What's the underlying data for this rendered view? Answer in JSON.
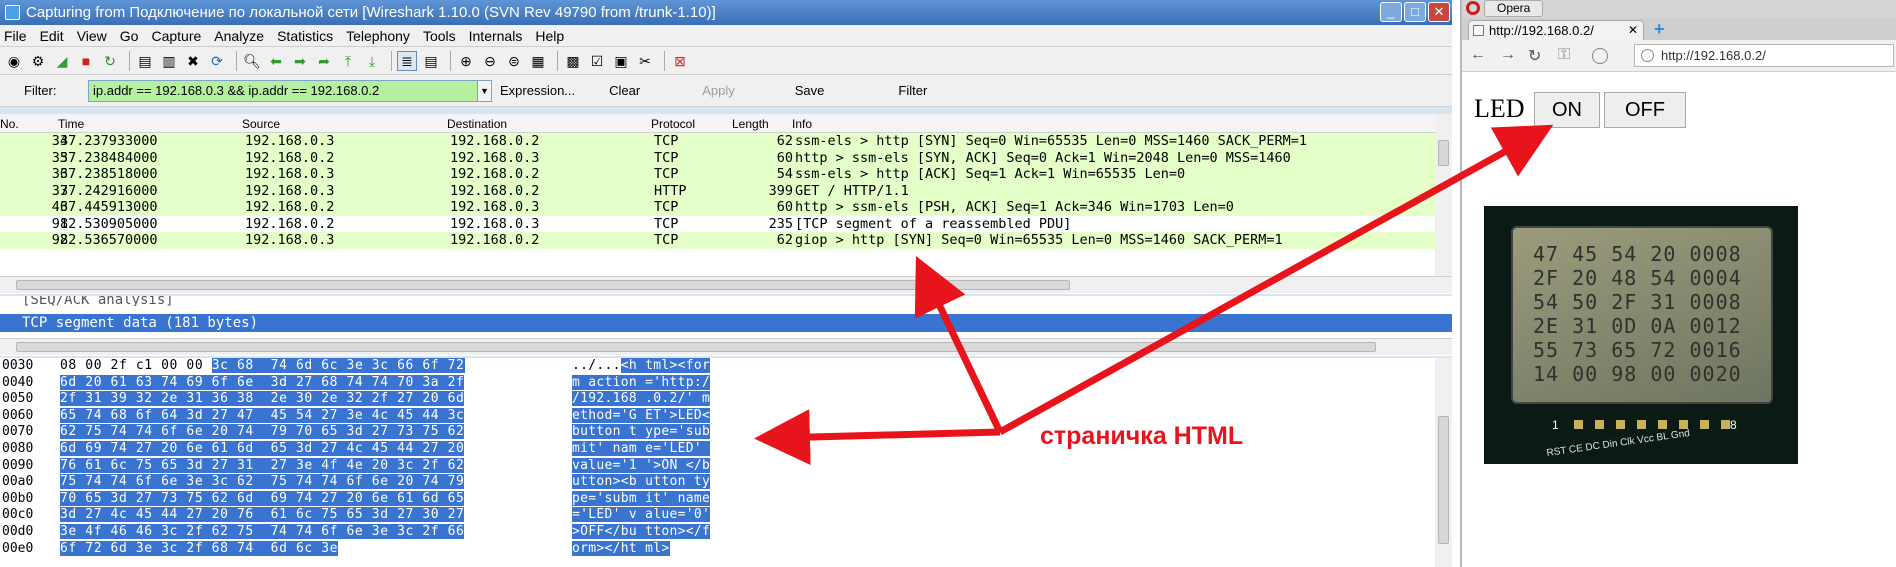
{
  "wireshark": {
    "title": "Capturing from Подключение по локальной сети    [Wireshark 1.10.0  (SVN Rev 49790 from /trunk-1.10)]",
    "window_buttons": [
      "_",
      "□",
      "✕"
    ],
    "menu": [
      "File",
      "Edit",
      "View",
      "Go",
      "Capture",
      "Analyze",
      "Statistics",
      "Telephony",
      "Tools",
      "Internals",
      "Help"
    ],
    "filter": {
      "label": "Filter:",
      "value": "ip.addr == 192.168.0.3 && ip.addr == 192.168.0.2",
      "expression": "Expression...",
      "clear": "Clear",
      "apply": "Apply",
      "save": "Save",
      "filter_btn": "Filter"
    },
    "columns": {
      "no": "No.",
      "time": "Time",
      "source": "Source",
      "destination": "Destination",
      "protocol": "Protocol",
      "length": "Length",
      "info": "Info"
    },
    "packets": [
      {
        "no": "34",
        "time": "37.237933000",
        "src": "192.168.0.3",
        "dst": "192.168.0.2",
        "proto": "TCP",
        "len": "62",
        "info": "ssm-els > http [SYN] Seq=0 Win=65535 Len=0 MSS=1460 SACK_PERM=1",
        "bg": "#e4ffc7"
      },
      {
        "no": "35",
        "time": "37.238484000",
        "src": "192.168.0.2",
        "dst": "192.168.0.3",
        "proto": "TCP",
        "len": "60",
        "info": "http > ssm-els [SYN, ACK] Seq=0 Ack=1 Win=2048 Len=0 MSS=1460",
        "bg": "#e4ffc7"
      },
      {
        "no": "36",
        "time": "37.238518000",
        "src": "192.168.0.3",
        "dst": "192.168.0.2",
        "proto": "TCP",
        "len": "54",
        "info": "ssm-els > http [ACK] Seq=1 Ack=1 Win=65535 Len=0",
        "bg": "#e4ffc7"
      },
      {
        "no": "37",
        "time": "37.242916000",
        "src": "192.168.0.3",
        "dst": "192.168.0.2",
        "proto": "HTTP",
        "len": "399",
        "info": "GET / HTTP/1.1",
        "bg": "#e4ffc7"
      },
      {
        "no": "46",
        "time": "37.445913000",
        "src": "192.168.0.2",
        "dst": "192.168.0.3",
        "proto": "TCP",
        "len": "60",
        "info": "http > ssm-els [PSH, ACK] Seq=1 Ack=346 Win=1703 Len=0",
        "bg": "#e4ffc7"
      },
      {
        "no": "91",
        "time": "82.530905000",
        "src": "192.168.0.2",
        "dst": "192.168.0.3",
        "proto": "TCP",
        "len": "235",
        "info": "[TCP segment of a reassembled PDU]",
        "bg": "#ffffff"
      },
      {
        "no": "92",
        "time": "82.536570000",
        "src": "192.168.0.3",
        "dst": "192.168.0.2",
        "proto": "TCP",
        "len": "62",
        "info": "giop > http [SYN] Seq=0 Win=65535 Len=0 MSS=1460 SACK_PERM=1",
        "bg": "#e4ffc7"
      }
    ],
    "details": {
      "partial": "[SEQ/ACK analysis]",
      "selected": "TCP segment data (181 bytes)"
    },
    "bytes": [
      {
        "off": "0030",
        "hex_plain": "08 00 2f c1 00 00 ",
        "hex_hl": "3c 68  74 6d 6c 3e 3c 66 6f 72",
        "asc_plain": "../...",
        "asc_hl": "<h tml><for"
      },
      {
        "off": "0040",
        "hex_plain": "",
        "hex_hl": "6d 20 61 63 74 69 6f 6e  3d 27 68 74 74 70 3a 2f",
        "asc_plain": "",
        "asc_hl": "m action ='http:/"
      },
      {
        "off": "0050",
        "hex_plain": "",
        "hex_hl": "2f 31 39 32 2e 31 36 38  2e 30 2e 32 2f 27 20 6d",
        "asc_plain": "",
        "asc_hl": "/192.168 .0.2/' m"
      },
      {
        "off": "0060",
        "hex_plain": "",
        "hex_hl": "65 74 68 6f 64 3d 27 47  45 54 27 3e 4c 45 44 3c",
        "asc_plain": "",
        "asc_hl": "ethod='G ET'>LED<"
      },
      {
        "off": "0070",
        "hex_plain": "",
        "hex_hl": "62 75 74 74 6f 6e 20 74  79 70 65 3d 27 73 75 62",
        "asc_plain": "",
        "asc_hl": "button t ype='sub"
      },
      {
        "off": "0080",
        "hex_plain": "",
        "hex_hl": "6d 69 74 27 20 6e 61 6d  65 3d 27 4c 45 44 27 20",
        "asc_plain": "",
        "asc_hl": "mit' nam e='LED' "
      },
      {
        "off": "0090",
        "hex_plain": "",
        "hex_hl": "76 61 6c 75 65 3d 27 31  27 3e 4f 4e 20 3c 2f 62",
        "asc_plain": "",
        "asc_hl": "value='1 '>ON </b"
      },
      {
        "off": "00a0",
        "hex_plain": "",
        "hex_hl": "75 74 74 6f 6e 3e 3c 62  75 74 74 6f 6e 20 74 79",
        "asc_plain": "",
        "asc_hl": "utton><b utton ty"
      },
      {
        "off": "00b0",
        "hex_plain": "",
        "hex_hl": "70 65 3d 27 73 75 62 6d  69 74 27 20 6e 61 6d 65",
        "asc_plain": "",
        "asc_hl": "pe='subm it' name"
      },
      {
        "off": "00c0",
        "hex_plain": "",
        "hex_hl": "3d 27 4c 45 44 27 20 76  61 6c 75 65 3d 27 30 27",
        "asc_plain": "",
        "asc_hl": "='LED' v alue='0'"
      },
      {
        "off": "00d0",
        "hex_plain": "",
        "hex_hl": "3e 4f 46 46 3c 2f 62 75  74 74 6f 6e 3e 3c 2f 66",
        "asc_plain": "",
        "asc_hl": ">OFF</bu tton></f"
      },
      {
        "off": "00e0",
        "hex_plain": "",
        "hex_hl": "6f 72 6d 3e 3c 2f 68 74  6d 6c 3e",
        "asc_plain": "",
        "asc_hl": "orm></ht ml>"
      }
    ]
  },
  "opera": {
    "app_name": "Opera",
    "tab_title": "http://192.168.0.2/",
    "tab_close": "✕",
    "new_tab": "+",
    "address": "http://192.168.0.2/",
    "nav": [
      "←",
      "→",
      "↻",
      "⚿"
    ],
    "page": {
      "label": "LED",
      "on": "ON",
      "off": "OFF"
    }
  },
  "lcd": {
    "lines": [
      "47 45 54 20 0008",
      "2F 20 48 54 0004",
      "54 50 2F 31 0008",
      "2E 31 0D 0A 0012",
      "55 73 65 72 0016",
      "14 00 98 00 0020"
    ],
    "pin_first": "1",
    "pin_last": "8",
    "pin_labels": "RST CE DC Din Clk Vcc BL Gnd"
  },
  "annotation": "страничка HTML",
  "colors": {
    "arrow": "#e8141c",
    "selection": "#3874d0",
    "tcp_row": "#e4ffc7",
    "filter_ok": "#b5f0a0"
  }
}
